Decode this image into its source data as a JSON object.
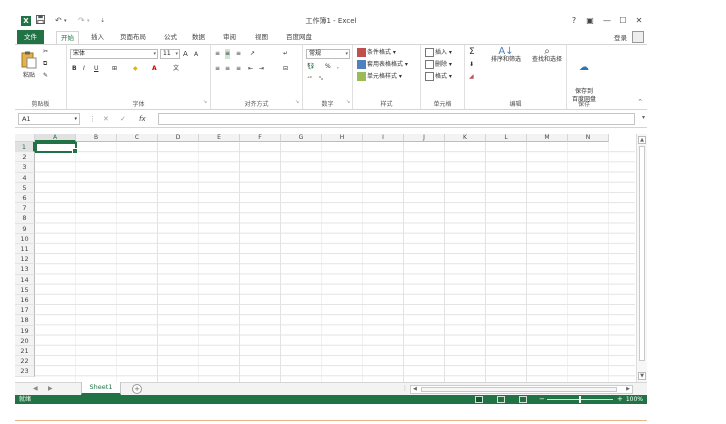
{
  "window": {
    "title": "工作簿1 - Excel",
    "app_icon": "X"
  },
  "quick_access": {
    "save_icon": "save-icon",
    "undo": "↶",
    "redo": "↷"
  },
  "window_controls": {
    "help": "?",
    "ribbon_options": "▣",
    "minimize": "—",
    "restore": "☐",
    "close": "✕"
  },
  "tabs": [
    {
      "label": "文件"
    },
    {
      "label": "开始"
    },
    {
      "label": "插入"
    },
    {
      "label": "页面布局"
    },
    {
      "label": "公式"
    },
    {
      "label": "数据"
    },
    {
      "label": "审阅"
    },
    {
      "label": "视图"
    },
    {
      "label": "百度网盘"
    }
  ],
  "account": {
    "login": "登录"
  },
  "ribbon": {
    "clipboard": {
      "label": "剪贴板",
      "paste": "粘贴"
    },
    "font": {
      "label": "字体",
      "family": "宋体",
      "size": "11",
      "bold": "B",
      "italic": "I",
      "underline": "U",
      "grow": "A",
      "shrink": "A",
      "font_color": "A"
    },
    "alignment": {
      "label": "对齐方式"
    },
    "number": {
      "label": "数字",
      "format": "常规",
      "percent": "%",
      "comma": ","
    },
    "styles": {
      "label": "样式",
      "conditional": "条件格式",
      "table": "套用表格格式",
      "cell_styles": "单元格样式"
    },
    "cells": {
      "label": "单元格",
      "insert": "插入",
      "delete": "删除",
      "format": "格式"
    },
    "editing": {
      "label": "编辑",
      "sum": "Σ",
      "sort": "排序和筛选",
      "find": "查找和选择"
    },
    "save": {
      "label": "保存",
      "button": "保存到\n百度网盘"
    }
  },
  "formula_bar": {
    "name_box": "A1",
    "cancel": "✕",
    "enter": "✓",
    "fx": "fx",
    "value": ""
  },
  "columns": [
    "A",
    "B",
    "C",
    "D",
    "E",
    "F",
    "G",
    "H",
    "I",
    "J",
    "K",
    "L",
    "M",
    "N"
  ],
  "rows": [
    "1",
    "2",
    "3",
    "4",
    "5",
    "6",
    "7",
    "8",
    "9",
    "10",
    "11",
    "12",
    "13",
    "14",
    "15",
    "16",
    "17",
    "18",
    "19",
    "20",
    "21",
    "22",
    "23"
  ],
  "selected_cell": "A1",
  "sheet_tabs": [
    {
      "label": "Sheet1"
    }
  ],
  "status_bar": {
    "status": "就绪",
    "zoom": "100%",
    "zoom_minus": "−",
    "zoom_plus": "+"
  },
  "colors": {
    "accent": "#217346"
  }
}
